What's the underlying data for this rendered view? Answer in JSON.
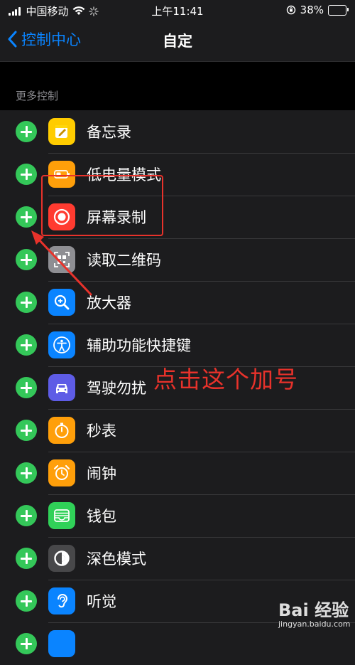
{
  "status_bar": {
    "carrier": "中国移动",
    "time": "上午11:41",
    "battery": "38%",
    "battery_level": 0.38
  },
  "nav": {
    "back_label": "控制中心",
    "title": "自定"
  },
  "section": {
    "header": "更多控制"
  },
  "items": [
    {
      "label": "备忘录",
      "icon": "notes-icon",
      "color": "#ffcc00"
    },
    {
      "label": "低电量模式",
      "icon": "battery-icon",
      "color": "#ff9f0a"
    },
    {
      "label": "屏幕录制",
      "icon": "screen-record-icon",
      "color": "#ff3b30"
    },
    {
      "label": "读取二维码",
      "icon": "qr-code-icon",
      "color": "#8e8e93"
    },
    {
      "label": "放大器",
      "icon": "magnifier-icon",
      "color": "#0a84ff"
    },
    {
      "label": "辅助功能快捷键",
      "icon": "accessibility-icon",
      "color": "#0a84ff"
    },
    {
      "label": "驾驶勿扰",
      "icon": "car-icon",
      "color": "#5e5ce6"
    },
    {
      "label": "秒表",
      "icon": "stopwatch-icon",
      "color": "#ff9f0a"
    },
    {
      "label": "闹钟",
      "icon": "alarm-icon",
      "color": "#ff9f0a"
    },
    {
      "label": "钱包",
      "icon": "wallet-icon",
      "color": "#30d158"
    },
    {
      "label": "深色模式",
      "icon": "dark-mode-icon",
      "color": "#48484a"
    },
    {
      "label": "听觉",
      "icon": "hearing-icon",
      "color": "#0a84ff"
    },
    {
      "label": "",
      "icon": "partial-icon",
      "color": "#0a84ff"
    }
  ],
  "annotation": {
    "text": "点击这个加号",
    "color": "#e8322b"
  },
  "watermark": {
    "logo": "Bai 经验",
    "url": "jingyan.baidu.com"
  }
}
